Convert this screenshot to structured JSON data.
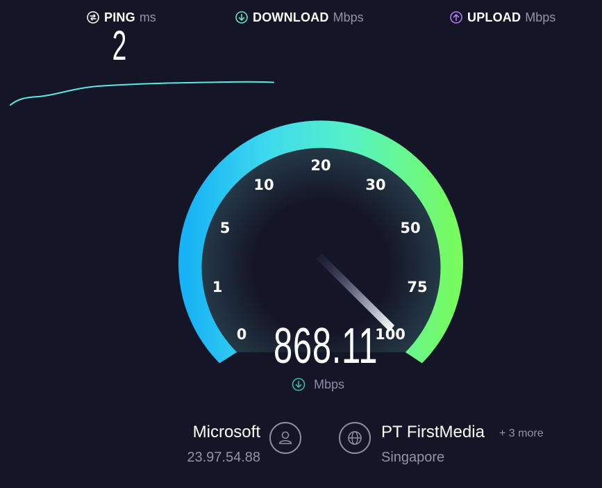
{
  "metrics": {
    "ping": {
      "label": "PING",
      "unit": "ms",
      "value": "2",
      "icon": "ping-icon"
    },
    "download": {
      "label": "DOWNLOAD",
      "unit": "Mbps",
      "icon": "download-arrow-icon",
      "color": "#5fe6c5"
    },
    "upload": {
      "label": "UPLOAD",
      "unit": "Mbps",
      "icon": "upload-arrow-icon",
      "color": "#b47cf0"
    }
  },
  "gauge": {
    "ticks": [
      "0",
      "1",
      "5",
      "10",
      "20",
      "30",
      "50",
      "75",
      "100"
    ],
    "value": "868.11",
    "unit": "Mbps",
    "colors": {
      "start": "#17b3f6",
      "mid": "#4ff0d8",
      "end": "#78fb5c"
    }
  },
  "host": {
    "name": "Microsoft",
    "ip": "23.97.54.88",
    "icon": "user-icon"
  },
  "isp": {
    "name": "PT FirstMedia",
    "more": "+ 3 more",
    "location": "Singapore",
    "icon": "globe-icon"
  },
  "colors": {
    "background": "#141526",
    "graph_line": "#5de8e8"
  }
}
